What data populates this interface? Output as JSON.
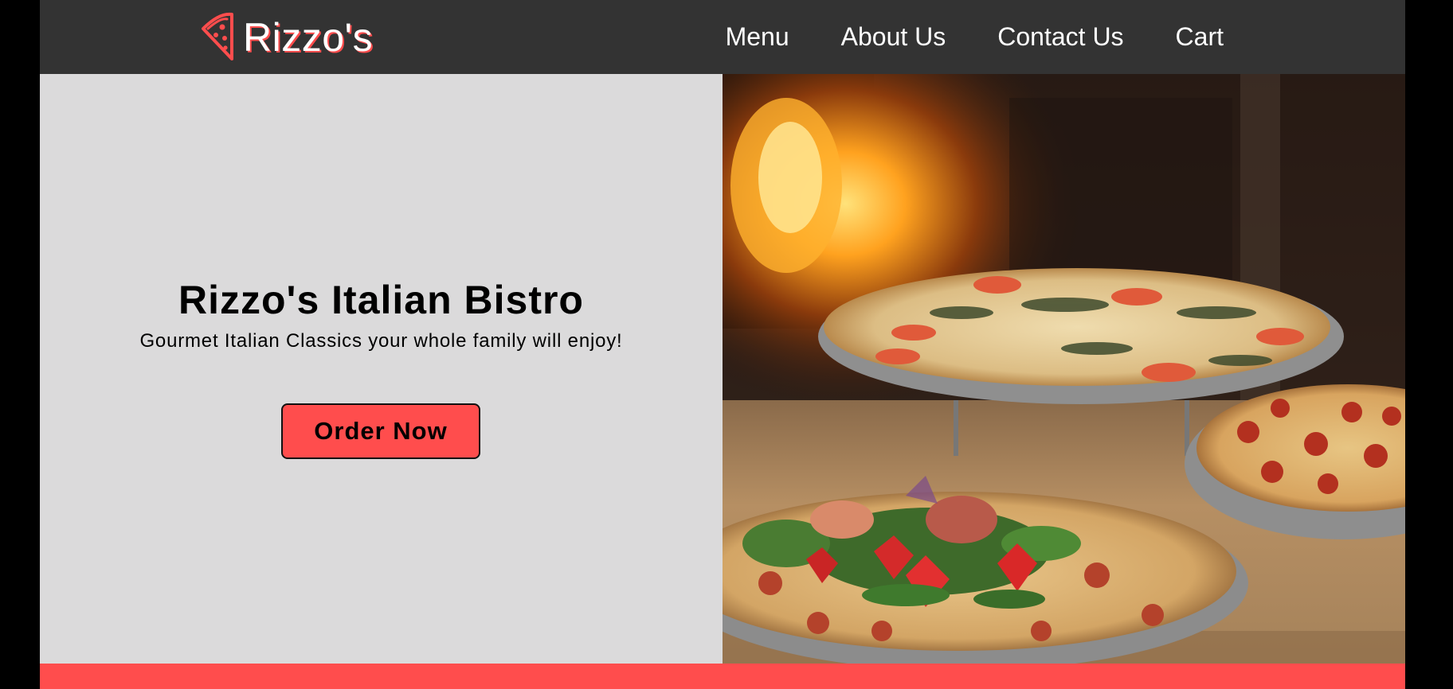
{
  "header": {
    "brand_name": "Rizzo's",
    "brand_icon": "pizza-slice-icon",
    "nav": [
      {
        "label": "Menu"
      },
      {
        "label": "About Us"
      },
      {
        "label": "Contact Us"
      },
      {
        "label": "Cart"
      }
    ]
  },
  "hero": {
    "title": "Rizzo's Italian Bistro",
    "subtitle": "Gourmet Italian Classics your whole family will enjoy!",
    "cta_label": "Order Now",
    "image_description_icon": "pizza-photo"
  },
  "colors": {
    "accent": "#ff4d4d",
    "navbar": "#333333",
    "hero_bg": "#dbdadb",
    "text": "#000000"
  }
}
